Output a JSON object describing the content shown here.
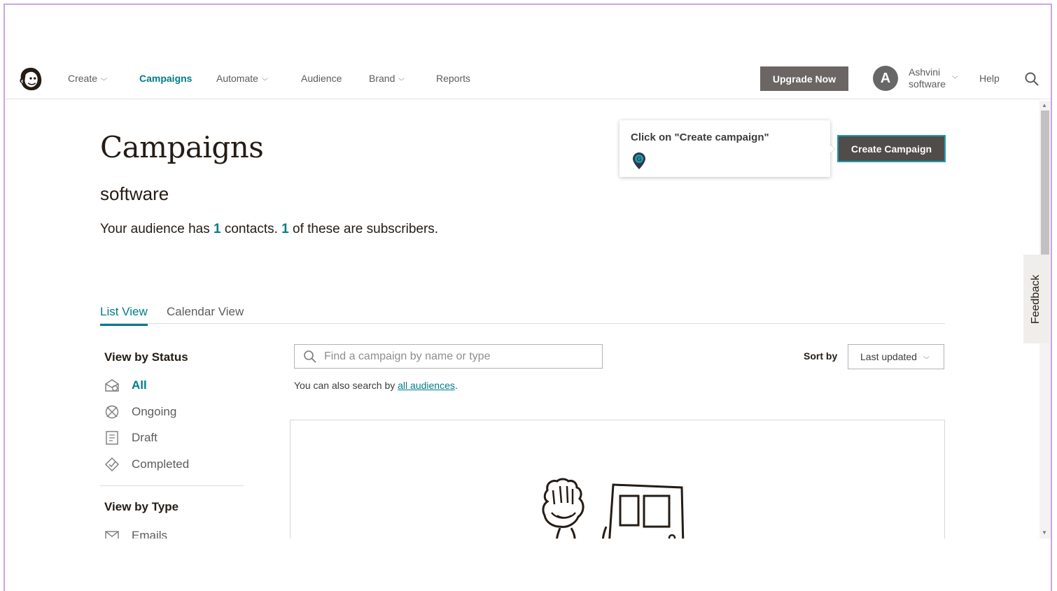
{
  "nav": {
    "items": [
      {
        "label": "Create",
        "has_dropdown": true
      },
      {
        "label": "Campaigns",
        "active": true
      },
      {
        "label": "Automate",
        "has_dropdown": true
      },
      {
        "label": "Audience"
      },
      {
        "label": "Brand",
        "has_dropdown": true
      },
      {
        "label": "Reports"
      }
    ],
    "upgrade_label": "Upgrade Now",
    "avatar_letter": "A",
    "account_name": "Ashvini",
    "account_org": "software",
    "help_label": "Help"
  },
  "page": {
    "title": "Campaigns",
    "subtitle": "software",
    "audience_prefix": "Your audience has ",
    "contacts_count": "1",
    "audience_mid": " contacts. ",
    "subscribers_count": "1",
    "audience_suffix": " of these are subscribers."
  },
  "tooltip": {
    "text": "Click on \"Create campaign\"",
    "pin_letter": "G"
  },
  "create_button_label": "Create Campaign",
  "feedback_label": "Feedback",
  "tabs": [
    {
      "label": "List View",
      "active": true
    },
    {
      "label": "Calendar View"
    }
  ],
  "filters": {
    "status_heading": "View by Status",
    "status_items": [
      {
        "label": "All",
        "active": true,
        "icon": "all-campaigns-icon"
      },
      {
        "label": "Ongoing",
        "icon": "ongoing-icon"
      },
      {
        "label": "Draft",
        "icon": "draft-icon"
      },
      {
        "label": "Completed",
        "icon": "completed-icon"
      }
    ],
    "type_heading": "View by Type",
    "type_items": [
      {
        "label": "Emails",
        "icon": "email-icon"
      }
    ]
  },
  "search": {
    "placeholder": "Find a campaign by name or type",
    "hint_prefix": "You can also search by ",
    "hint_link": "all audiences",
    "hint_suffix": "."
  },
  "sort": {
    "label": "Sort by",
    "selected": "Last updated"
  },
  "colors": {
    "accent": "#007c89",
    "upgrade_bg": "#6b6664",
    "create_bg": "#504c4a",
    "create_border": "#1f9bb0"
  }
}
